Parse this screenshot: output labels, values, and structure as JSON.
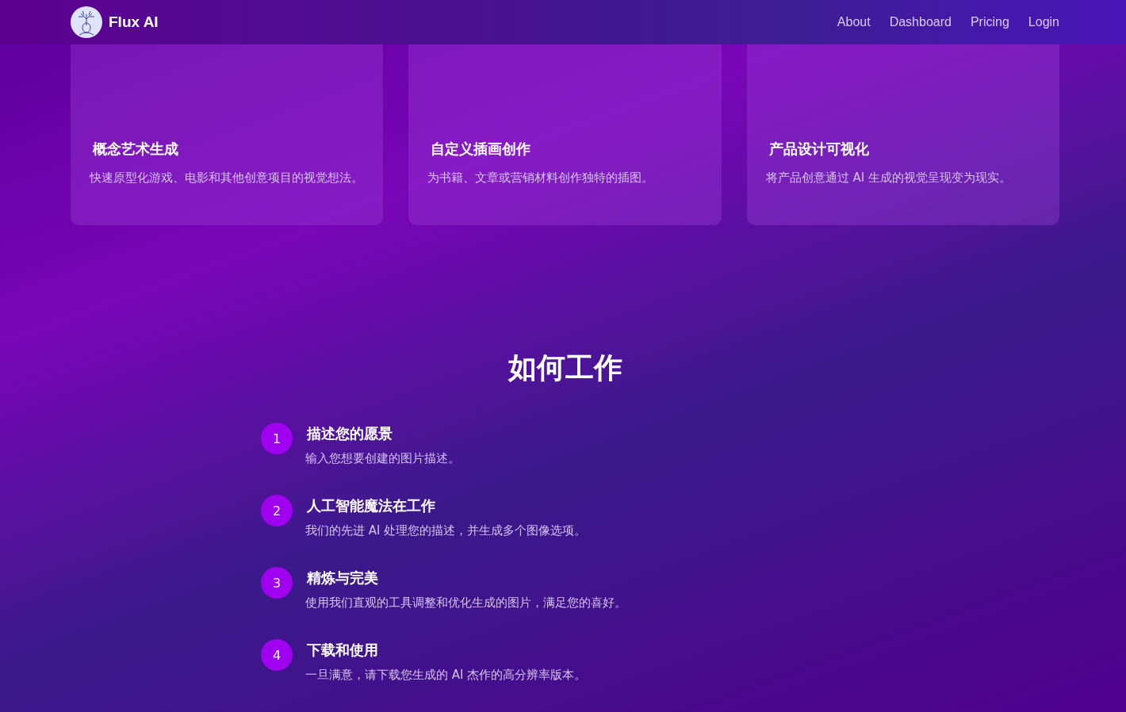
{
  "header": {
    "brand": "Flux AI",
    "nav": [
      "About",
      "Dashboard",
      "Pricing",
      "Login"
    ]
  },
  "cards": [
    {
      "title": "概念艺术生成",
      "description": "快速原型化游戏、电影和其他创意项目的视觉想法。"
    },
    {
      "title": "自定义插画创作",
      "description": "为书籍、文章或营销材料创作独特的插图。"
    },
    {
      "title": "产品设计可视化",
      "description": "将产品创意通过 AI 生成的视觉呈现变为现实。"
    }
  ],
  "how_it_works": {
    "heading": "如何工作",
    "steps": [
      {
        "number": "1",
        "title": "描述您的愿景",
        "description": "输入您想要创建的图片描述。"
      },
      {
        "number": "2",
        "title": "人工智能魔法在工作",
        "description": "我们的先进 AI 处理您的描述，并生成多个图像选项。"
      },
      {
        "number": "3",
        "title": "精炼与完美",
        "description": "使用我们直观的工具调整和优化生成的图片，满足您的喜好。"
      },
      {
        "number": "4",
        "title": "下载和使用",
        "description": "一旦满意，请下载您生成的 AI 杰作的高分辨率版本。"
      }
    ]
  }
}
